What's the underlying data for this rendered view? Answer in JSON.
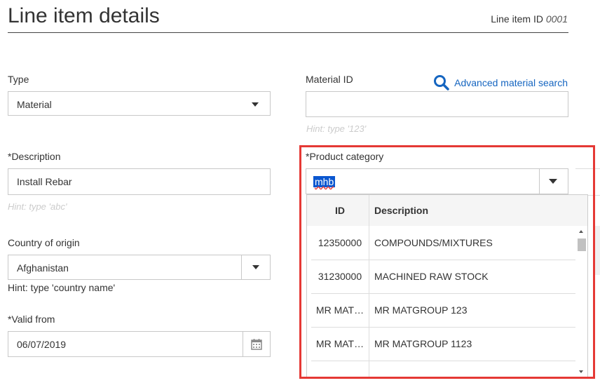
{
  "header": {
    "title": "Line item details",
    "line_item_label": "Line item ID",
    "line_item_id": "0001"
  },
  "type": {
    "label": "Type",
    "value": "Material"
  },
  "material_id": {
    "label": "Material ID",
    "value": "",
    "hint": "Hint: type '123'"
  },
  "advanced_search": {
    "label": "Advanced material search",
    "icon": "search-icon",
    "color": "#1565c0"
  },
  "description": {
    "label": "*Description",
    "value": "Install Rebar",
    "hint": "Hint: type 'abc'"
  },
  "product_category": {
    "label": "*Product category",
    "value": "mhb",
    "dropdown": {
      "columns": [
        "ID",
        "Description"
      ],
      "rows": [
        {
          "id": "12350000",
          "description": "COMPOUNDS/MIXTURES"
        },
        {
          "id": "31230000",
          "description": "MACHINED RAW STOCK"
        },
        {
          "id": "MR MAT…",
          "description": "MR MATGROUP 123"
        },
        {
          "id": "MR MAT…",
          "description": "MR MATGROUP 1123"
        }
      ]
    }
  },
  "country": {
    "label": "Country of origin",
    "value": "Afghanistan",
    "hint": "Hint: type 'country name'"
  },
  "valid_from": {
    "label": "*Valid from",
    "value": "06/07/2019",
    "icon": "calendar-icon"
  },
  "highlight_color": "#e53935"
}
